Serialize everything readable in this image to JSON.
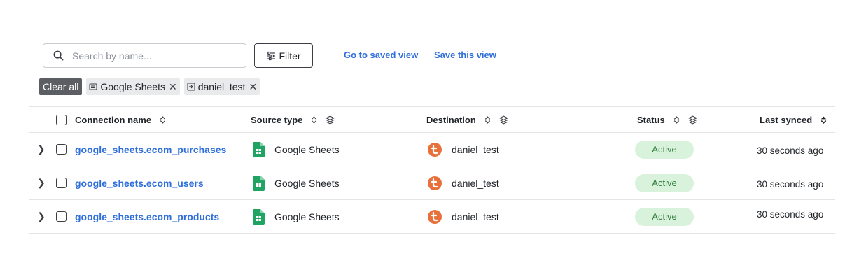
{
  "search": {
    "placeholder": "Search by name...",
    "value": ""
  },
  "toolbar": {
    "filter_label": "Filter",
    "saved_view_label": "Go to saved view",
    "save_view_label": "Save this view"
  },
  "chips": {
    "clear_all": "Clear all",
    "items": [
      {
        "label": "Google Sheets",
        "icon": "source-icon"
      },
      {
        "label": "daniel_test",
        "icon": "destination-icon"
      }
    ]
  },
  "table": {
    "columns": {
      "connection_name": "Connection name",
      "source_type": "Source type",
      "destination": "Destination",
      "status": "Status",
      "last_synced": "Last synced"
    },
    "rows": [
      {
        "name": "google_sheets.ecom_purchases",
        "source": "Google Sheets",
        "destination": "daniel_test",
        "status": "Active",
        "last_synced": "30 seconds ago"
      },
      {
        "name": "google_sheets.ecom_users",
        "source": "Google Sheets",
        "destination": "daniel_test",
        "status": "Active",
        "last_synced": "30 seconds ago"
      },
      {
        "name": "google_sheets.ecom_products",
        "source": "Google Sheets",
        "destination": "daniel_test",
        "status": "Active",
        "last_synced": "30 seconds ago"
      }
    ]
  },
  "colors": {
    "link": "#2f6fdb",
    "status_bg": "#d9f2dc",
    "status_text": "#2e7d3a",
    "sheets_green": "#1fa463",
    "destination_orange": "#e8703a"
  }
}
